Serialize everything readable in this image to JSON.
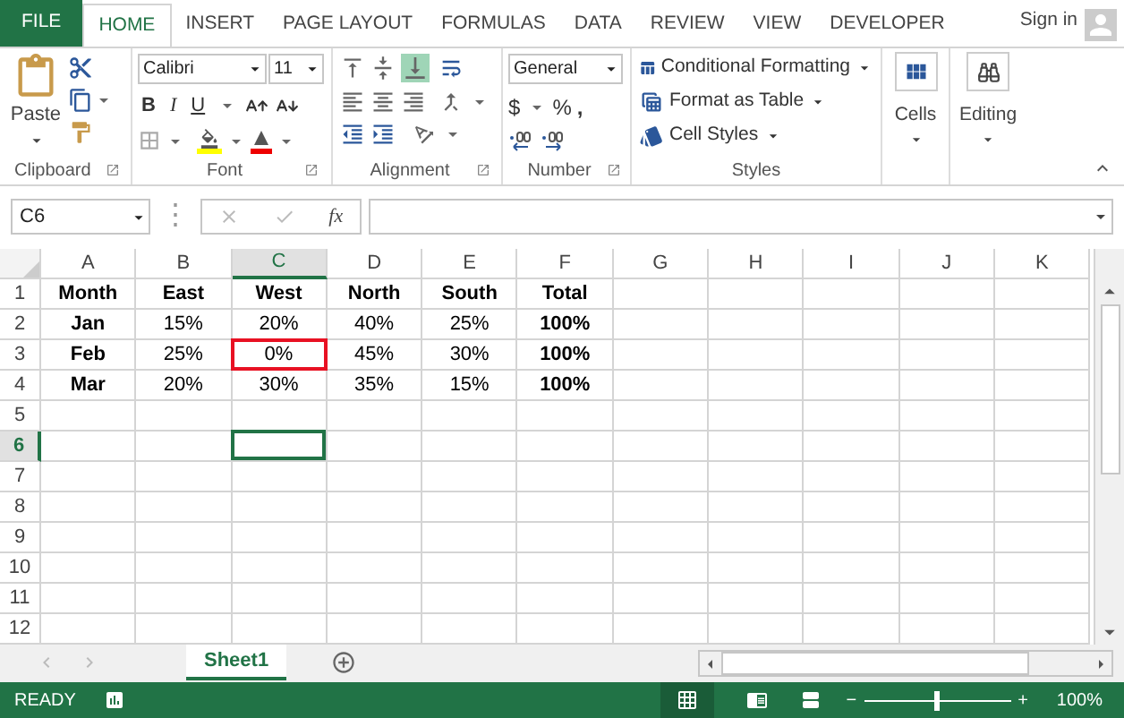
{
  "menu_tabs": [
    {
      "label": "FILE",
      "kind": "file",
      "selected": false
    },
    {
      "label": "HOME",
      "kind": "tab",
      "selected": true
    },
    {
      "label": "INSERT",
      "kind": "tab",
      "selected": false
    },
    {
      "label": "PAGE LAYOUT",
      "kind": "tab",
      "selected": false
    },
    {
      "label": "FORMULAS",
      "kind": "tab",
      "selected": false
    },
    {
      "label": "DATA",
      "kind": "tab",
      "selected": false
    },
    {
      "label": "REVIEW",
      "kind": "tab",
      "selected": false
    },
    {
      "label": "VIEW",
      "kind": "tab",
      "selected": false
    },
    {
      "label": "DEVELOPER",
      "kind": "tab",
      "selected": false
    }
  ],
  "sign_in": "Sign in",
  "ribbon": {
    "clipboard": {
      "paste": "Paste",
      "label": "Clipboard"
    },
    "font": {
      "name": "Calibri",
      "size": "11",
      "bold": "B",
      "italic": "I",
      "underline": "U",
      "label": "Font"
    },
    "alignment": {
      "label": "Alignment"
    },
    "number": {
      "format": "General",
      "currency": "$",
      "percent": "%",
      "comma": ",",
      "label": "Number"
    },
    "styles": {
      "items": [
        "Conditional Formatting",
        "Format as Table",
        "Cell Styles"
      ],
      "label": "Styles"
    },
    "cells": "Cells",
    "editing": "Editing"
  },
  "formula_bar": {
    "name_box": "C6",
    "grip": "⋮",
    "function_glyph": "fx"
  },
  "grid": {
    "columns": [
      {
        "label": "A",
        "selected": false
      },
      {
        "label": "B",
        "selected": false
      },
      {
        "label": "C",
        "selected": true
      },
      {
        "label": "D",
        "selected": false
      },
      {
        "label": "E",
        "selected": false
      },
      {
        "label": "F",
        "selected": false
      },
      {
        "label": "G",
        "selected": false
      },
      {
        "label": "H",
        "selected": false
      },
      {
        "label": "I",
        "selected": false
      },
      {
        "label": "J",
        "selected": false
      },
      {
        "label": "K",
        "selected": false
      }
    ],
    "rows": [
      {
        "label": "1",
        "selected": false,
        "cells": [
          {
            "text": "Month",
            "bold": true
          },
          {
            "text": "East",
            "bold": true
          },
          {
            "text": "West",
            "bold": true
          },
          {
            "text": "North",
            "bold": true
          },
          {
            "text": "South",
            "bold": true
          },
          {
            "text": "Total",
            "bold": true
          }
        ]
      },
      {
        "label": "2",
        "selected": false,
        "cells": [
          {
            "text": "Jan",
            "bold": true
          },
          {
            "text": "15%",
            "bold": false
          },
          {
            "text": "20%",
            "bold": false
          },
          {
            "text": "40%",
            "bold": false
          },
          {
            "text": "25%",
            "bold": false
          },
          {
            "text": "100%",
            "bold": true
          }
        ]
      },
      {
        "label": "3",
        "selected": false,
        "cells": [
          {
            "text": "Feb",
            "bold": true
          },
          {
            "text": "25%",
            "bold": false
          },
          {
            "text": "0%",
            "bold": false,
            "flagged": true
          },
          {
            "text": "45%",
            "bold": false
          },
          {
            "text": "30%",
            "bold": false
          },
          {
            "text": "100%",
            "bold": true
          }
        ]
      },
      {
        "label": "4",
        "selected": false,
        "cells": [
          {
            "text": "Mar",
            "bold": true
          },
          {
            "text": "20%",
            "bold": false
          },
          {
            "text": "30%",
            "bold": false
          },
          {
            "text": "35%",
            "bold": false
          },
          {
            "text": "15%",
            "bold": false
          },
          {
            "text": "100%",
            "bold": true
          }
        ]
      },
      {
        "label": "5",
        "selected": false,
        "cells": []
      },
      {
        "label": "6",
        "selected": true,
        "cells": []
      },
      {
        "label": "7",
        "selected": false,
        "cells": []
      },
      {
        "label": "8",
        "selected": false,
        "cells": []
      },
      {
        "label": "9",
        "selected": false,
        "cells": []
      },
      {
        "label": "10",
        "selected": false,
        "cells": []
      },
      {
        "label": "11",
        "selected": false,
        "cells": []
      },
      {
        "label": "12",
        "selected": false,
        "cells": []
      }
    ]
  },
  "sheet_tabs": [
    {
      "label": "Sheet1",
      "selected": true
    }
  ],
  "status_bar": {
    "status": "READY",
    "zoom_out": "−",
    "zoom_in": "+",
    "zoom": "100%",
    "level": 0.5
  }
}
